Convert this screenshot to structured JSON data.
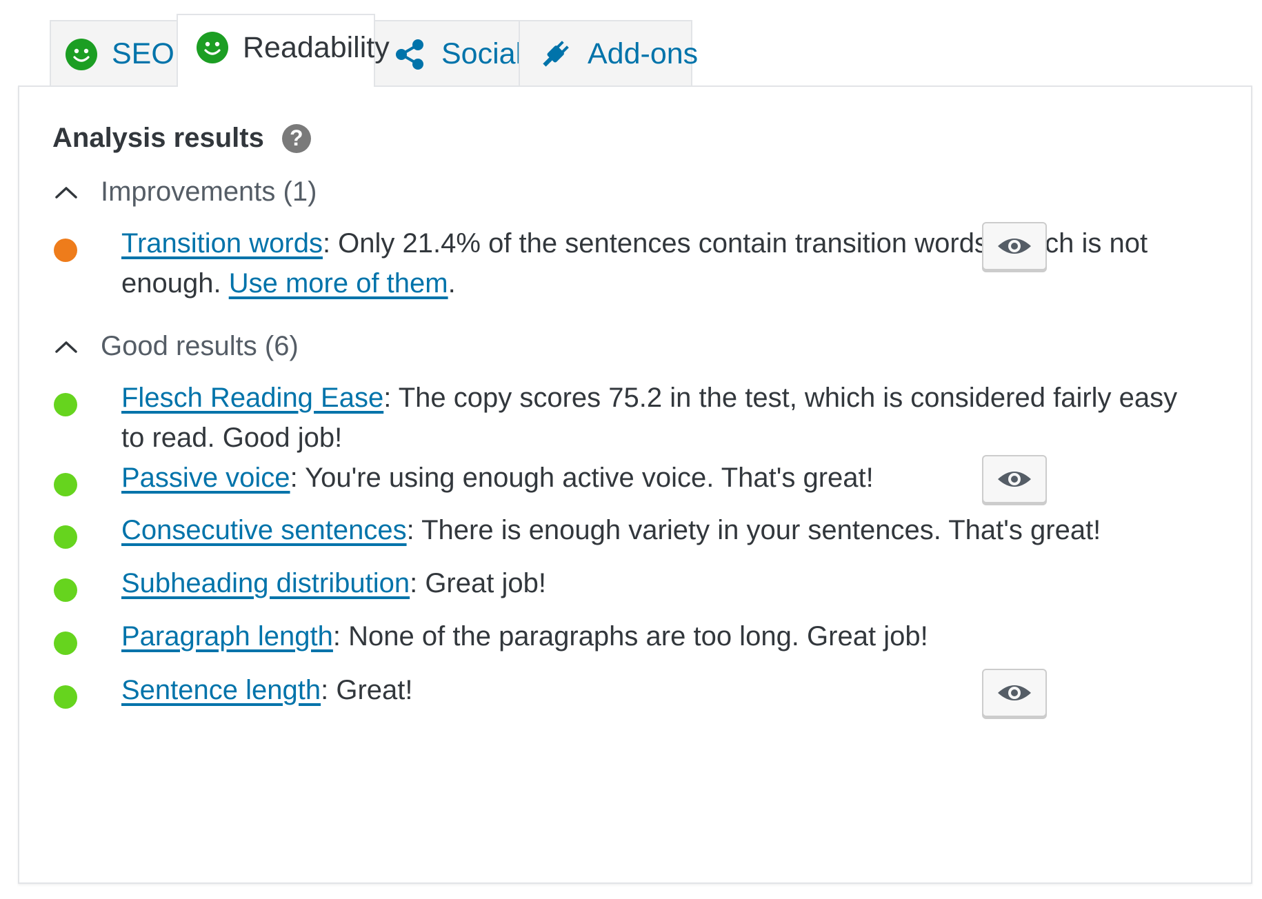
{
  "tabs": [
    {
      "label": "SEO",
      "icon": "smiley-face-icon",
      "color": "#0073aa"
    },
    {
      "label": "Readability",
      "icon": "smiley-face-icon",
      "active": true
    },
    {
      "label": "Social",
      "icon": "share-icon"
    },
    {
      "label": "Add-ons",
      "icon": "plug-icon"
    }
  ],
  "panel": {
    "heading": "Analysis results",
    "help_icon": "?",
    "improvements": {
      "label": "Improvements (1)",
      "items": [
        {
          "link": "Transition words",
          "text": ": Only 21.4% of the sentences contain transition words, which is not enough. ",
          "link2": "Use more of them",
          "tail": ".",
          "status": "orange"
        }
      ]
    },
    "good": {
      "label": "Good results (6)",
      "items": [
        {
          "link": "Flesch Reading Ease",
          "text": ": The copy scores 75.2 in the test, which is considered fairly easy to read. Good job!"
        },
        {
          "link": "Passive voice",
          "text": ": You're using enough active voice. That's great!"
        },
        {
          "link": "Consecutive sentences",
          "text": ": There is enough variety in your sentences. That's great!"
        },
        {
          "link": "Subheading distribution",
          "text": ": Great job!"
        },
        {
          "link": "Paragraph length",
          "text": ": None of the paragraphs are too long. Great job!"
        },
        {
          "link": "Sentence length",
          "text": ": Great!"
        }
      ]
    }
  },
  "colors": {
    "good": "#66d41e",
    "improvement": "#ee7c1b",
    "link": "#0073aa",
    "smiley": "#1c9e23"
  }
}
